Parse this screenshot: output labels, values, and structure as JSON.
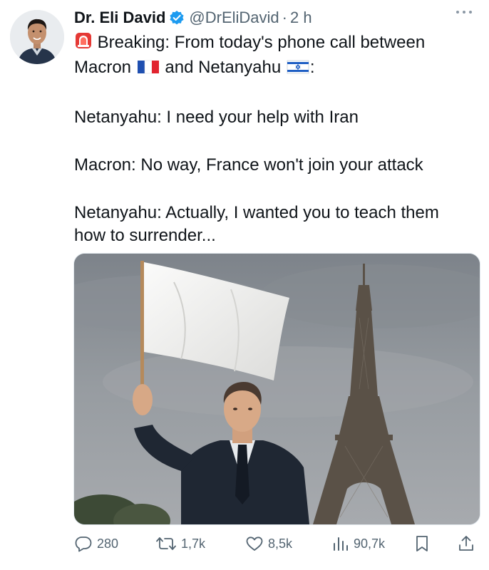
{
  "author": {
    "name": "Dr. Eli David",
    "handle": "@DrEliDavid",
    "separator": "·",
    "time": "2 h",
    "verified": true
  },
  "tweet": {
    "lines": [
      "Breaking: From today's phone call between",
      "Macron",
      "and Netanyahu",
      ":",
      "Netanyahu: I need your help with Iran",
      "Macron: No way, France won't join your attack",
      "Netanyahu: Actually, I wanted you to teach them",
      "how to surrender..."
    ],
    "icons": [
      "siren-emoji",
      "france-flag",
      "israel-flag"
    ]
  },
  "media": {
    "subject": "photo",
    "colors": {
      "sky": "#8e949a",
      "flag": "#f2f2f0",
      "suit": "#1f2733",
      "tower": "#5b5248"
    }
  },
  "actions": {
    "reply_count": "280",
    "repost_count": "1,7k",
    "like_count": "8,5k",
    "view_count": "90,7k"
  },
  "colors": {
    "text": "#0f1419",
    "muted": "#536471",
    "verified_blue": "#1d9bf0"
  }
}
